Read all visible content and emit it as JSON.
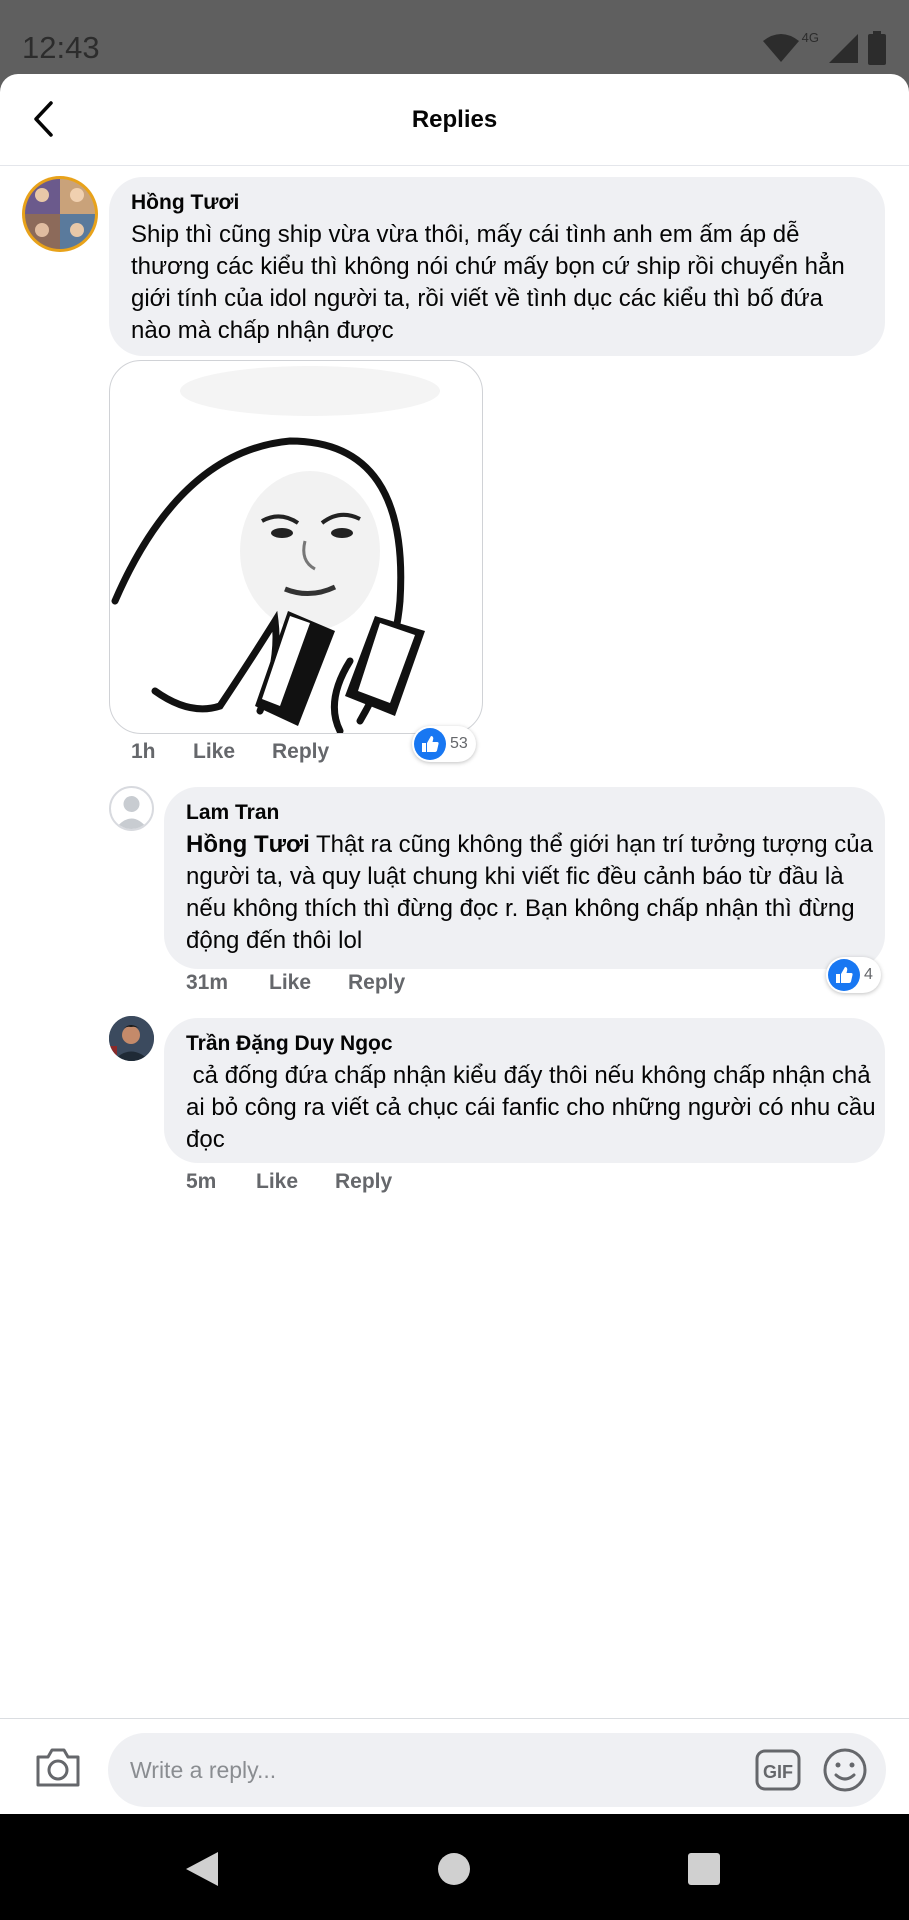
{
  "status_bar": {
    "time": "12:43",
    "network": "4G"
  },
  "header": {
    "title": "Replies"
  },
  "comments": [
    {
      "author": "Hồng Tươi",
      "text": "Ship thì cũng ship vừa vừa thôi, mấy cái tình anh em ấm áp dễ thương các kiểu thì không nói chứ mấy bọn cứ ship rồi chuyển hẳn giới tính của idol người ta, rồi viết về tình dục các kiểu thì bố đứa nào mà chấp nhận được",
      "time": "1h",
      "like_label": "Like",
      "reply_label": "Reply",
      "reaction_count": "53"
    },
    {
      "author": "Lam Tran",
      "mention": "Hồng Tươi",
      "text": " Thật ra cũng không thể giới hạn trí tưởng tượng của người ta, và quy luật chung khi viết fic đều cảnh báo từ đầu là nếu không thích thì đừng đọc r. Bạn không chấp nhận thì đừng động đến thôi lol",
      "time": "31m",
      "like_label": "Like",
      "reply_label": "Reply",
      "reaction_count": "4"
    },
    {
      "author": "Trần Đặng Duy Ngọc",
      "text": " cả đống đứa chấp nhận kiểu đấy thôi nếu không chấp nhận chả ai bỏ công ra viết cả chục cái fanfic cho những người có nhu cầu đọc",
      "time": "5m",
      "like_label": "Like",
      "reply_label": "Reply"
    }
  ],
  "composer": {
    "placeholder": "Write a reply..."
  },
  "colors": {
    "accent": "#1877f2",
    "bubble": "#eff0f3",
    "meta": "#65676b"
  },
  "icons": [
    "back-arrow-icon",
    "camera-icon",
    "gif-icon",
    "emoji-icon",
    "thumbs-up-icon",
    "wifi-icon",
    "signal-icon",
    "battery-icon"
  ]
}
